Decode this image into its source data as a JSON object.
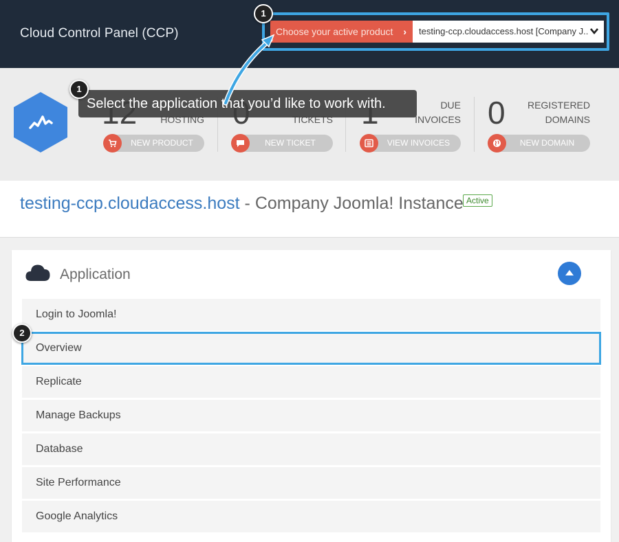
{
  "header": {
    "app_title": "Cloud Control Panel (CCP)",
    "product_label": "Choose your active product",
    "product_value": "testing-ccp.cloudaccess.host [Company J..."
  },
  "callouts": {
    "badge1": "1",
    "badge2": "2",
    "tooltip": "Select the application that you’d like to work with."
  },
  "stats": [
    {
      "number": "12",
      "label_line1": "",
      "label_line2": "HOSTING",
      "button": "NEW PRODUCT",
      "icon": "cart-icon"
    },
    {
      "number": "0",
      "label_line1": "",
      "label_line2": "TICKETS",
      "button": "NEW TICKET",
      "icon": "chat-bubble-icon"
    },
    {
      "number": "1",
      "label_line1": "DUE",
      "label_line2": "INVOICES",
      "button": "VIEW INVOICES",
      "icon": "list-icon"
    },
    {
      "number": "0",
      "label_line1": "REGISTERED",
      "label_line2": "DOMAINS",
      "button": "NEW DOMAIN",
      "icon": "globe-icon"
    }
  ],
  "site": {
    "host": "testing-ccp.cloudaccess.host",
    "separator": " - ",
    "name": "Company Joomla! Instance",
    "status": "Active"
  },
  "application": {
    "title": "Application",
    "items": [
      "Login to Joomla!",
      "Overview",
      "Replicate",
      "Manage Backups",
      "Database",
      "Site Performance",
      "Google Analytics"
    ]
  },
  "colors": {
    "header_bg": "#1f2b3a",
    "accent_red": "#e25b49",
    "highlight_blue": "#3ea6e3",
    "link_blue": "#3b7bbf",
    "status_green": "#3e8a2e"
  }
}
